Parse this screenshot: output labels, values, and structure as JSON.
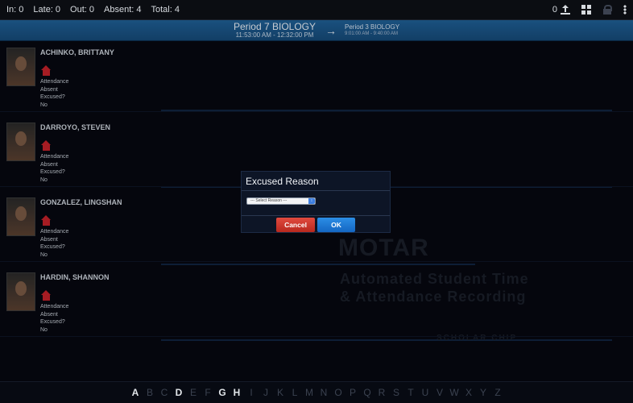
{
  "topbar": {
    "in": "In: 0",
    "late": "Late: 0",
    "out": "Out: 0",
    "absent": "Absent: 4",
    "total": "Total: 4",
    "upload_count": "0"
  },
  "period": {
    "current_name": "Period 7 BIOLOGY",
    "current_time": "11:53:00 AM - 12:32:00 PM",
    "next_name": "Period 3 BIOLOGY",
    "next_time": "9:01:00 AM - 9:40:00 AM"
  },
  "background": {
    "big": "MOTAR",
    "line1": "Automated Student Time",
    "line2": "& Attendance Recording",
    "brand": "SCHOLAR CHIP"
  },
  "students": [
    {
      "name": "ACHINKO, BRITTANY",
      "attendance_label": "Attendance",
      "attendance_value": "Absent",
      "excused_label": "Excused?",
      "excused_value": "No"
    },
    {
      "name": "DARROYO, STEVEN",
      "attendance_label": "Attendance",
      "attendance_value": "Absent",
      "excused_label": "Excused?",
      "excused_value": "No"
    },
    {
      "name": "GONZALEZ, LINGSHAN",
      "attendance_label": "Attendance",
      "attendance_value": "Absent",
      "excused_label": "Excused?",
      "excused_value": "No"
    },
    {
      "name": "HARDIN, SHANNON",
      "attendance_label": "Attendance",
      "attendance_value": "Absent",
      "excused_label": "Excused?",
      "excused_value": "No"
    }
  ],
  "alphabet": [
    "A",
    "B",
    "C",
    "D",
    "E",
    "F",
    "G",
    "H",
    "I",
    "J",
    "K",
    "L",
    "M",
    "N",
    "O",
    "P",
    "Q",
    "R",
    "S",
    "T",
    "U",
    "V",
    "W",
    "X",
    "Y",
    "Z"
  ],
  "alphabet_active": [
    "A",
    "D",
    "G",
    "H"
  ],
  "dialog": {
    "title": "Excused Reason",
    "select_value": "--- Select Reason ---",
    "cancel_label": "Cancel",
    "ok_label": "OK"
  },
  "colors": {
    "period_bar": "#1f5f95",
    "home_icon": "#c4222a",
    "cancel": "#d43a30",
    "ok": "#1f7ad6"
  }
}
